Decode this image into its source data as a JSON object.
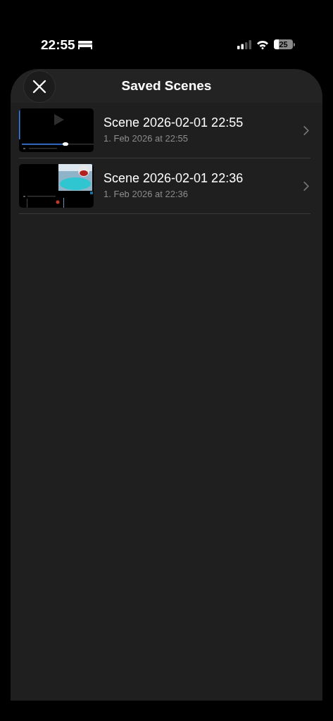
{
  "status_bar": {
    "time": "22:55",
    "battery": "25"
  },
  "sheet": {
    "title": "Saved Scenes"
  },
  "scenes": [
    {
      "title": "Scene 2026-02-01 22:55",
      "date": "1. Feb 2026 at 22:55"
    },
    {
      "title": "Scene 2026-02-01 22:36",
      "date": "1. Feb 2026 at 22:36"
    }
  ]
}
